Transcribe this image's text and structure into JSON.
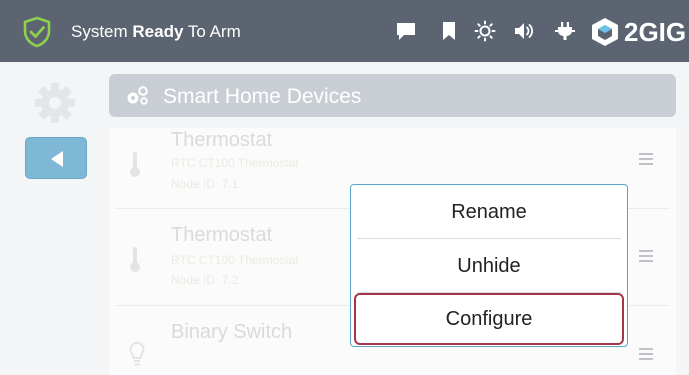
{
  "topbar": {
    "status_prefix": "System ",
    "status_bold": "Ready",
    "status_suffix": " To Arm",
    "logo_text": "2GIG",
    "icons": [
      "shield-check-icon",
      "message-icon",
      "bookmark-icon",
      "brightness-icon",
      "volume-icon",
      "power-plug-icon",
      "2gig-logo-icon"
    ]
  },
  "sidebar": {
    "icons": [
      "gear-icon",
      "back-arrow-icon"
    ]
  },
  "header": {
    "title": "Smart Home Devices",
    "icon": "smart-home-devices-icon"
  },
  "devices": [
    {
      "name": "Thermostat",
      "model": "RTC CT100 Thermostat",
      "node": "Node ID: 7.1",
      "icon": "thermometer-icon"
    },
    {
      "name": "Thermostat",
      "model": "RTC CT100 Thermostat",
      "node": "Node ID: 7.2",
      "icon": "thermometer-icon"
    },
    {
      "name": "Binary Switch",
      "model": "",
      "node": "",
      "icon": "lightbulb-icon"
    }
  ],
  "popup_menu": {
    "items": [
      "Rename",
      "Unhide",
      "Configure"
    ],
    "selected": "Configure"
  },
  "colors": {
    "topbar": "#5b6470",
    "back_button": "#7fb8d6",
    "popup_border": "#5ba6c4",
    "selected_border": "#a4364c",
    "shield": "#8fd14f"
  }
}
